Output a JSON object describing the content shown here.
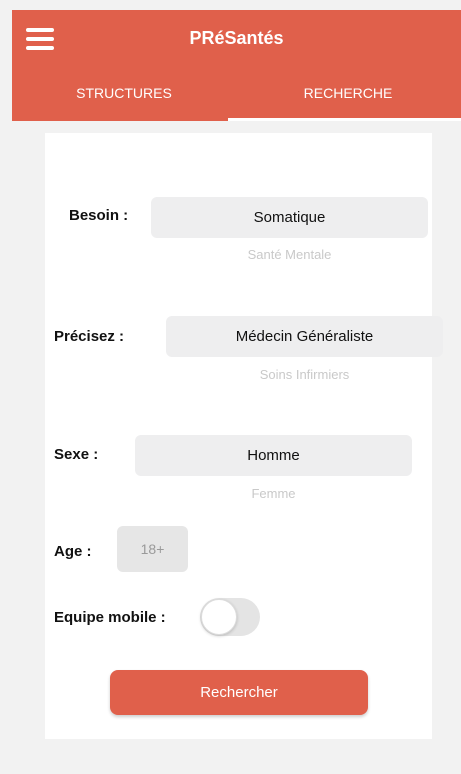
{
  "header": {
    "title": "PRéSantés",
    "tabs": [
      {
        "label": "STRUCTURES"
      },
      {
        "label": "RECHERCHE"
      }
    ]
  },
  "form": {
    "besoin": {
      "label": "Besoin :",
      "selected": "Somatique",
      "next_option": "Santé Mentale"
    },
    "precisez": {
      "label": "Précisez :",
      "selected": "Médecin Généraliste",
      "next_option": "Soins Infirmiers"
    },
    "sexe": {
      "label": "Sexe :",
      "selected": "Homme",
      "next_option": "Femme"
    },
    "age": {
      "label": "Age :",
      "placeholder": "18+"
    },
    "equipe_mobile": {
      "label": "Equipe mobile :",
      "on": false
    },
    "submit_label": "Rechercher"
  },
  "colors": {
    "accent": "#e0604b",
    "background": "#f2f2f2",
    "card": "#ffffff",
    "picker": "#eeeeef"
  }
}
